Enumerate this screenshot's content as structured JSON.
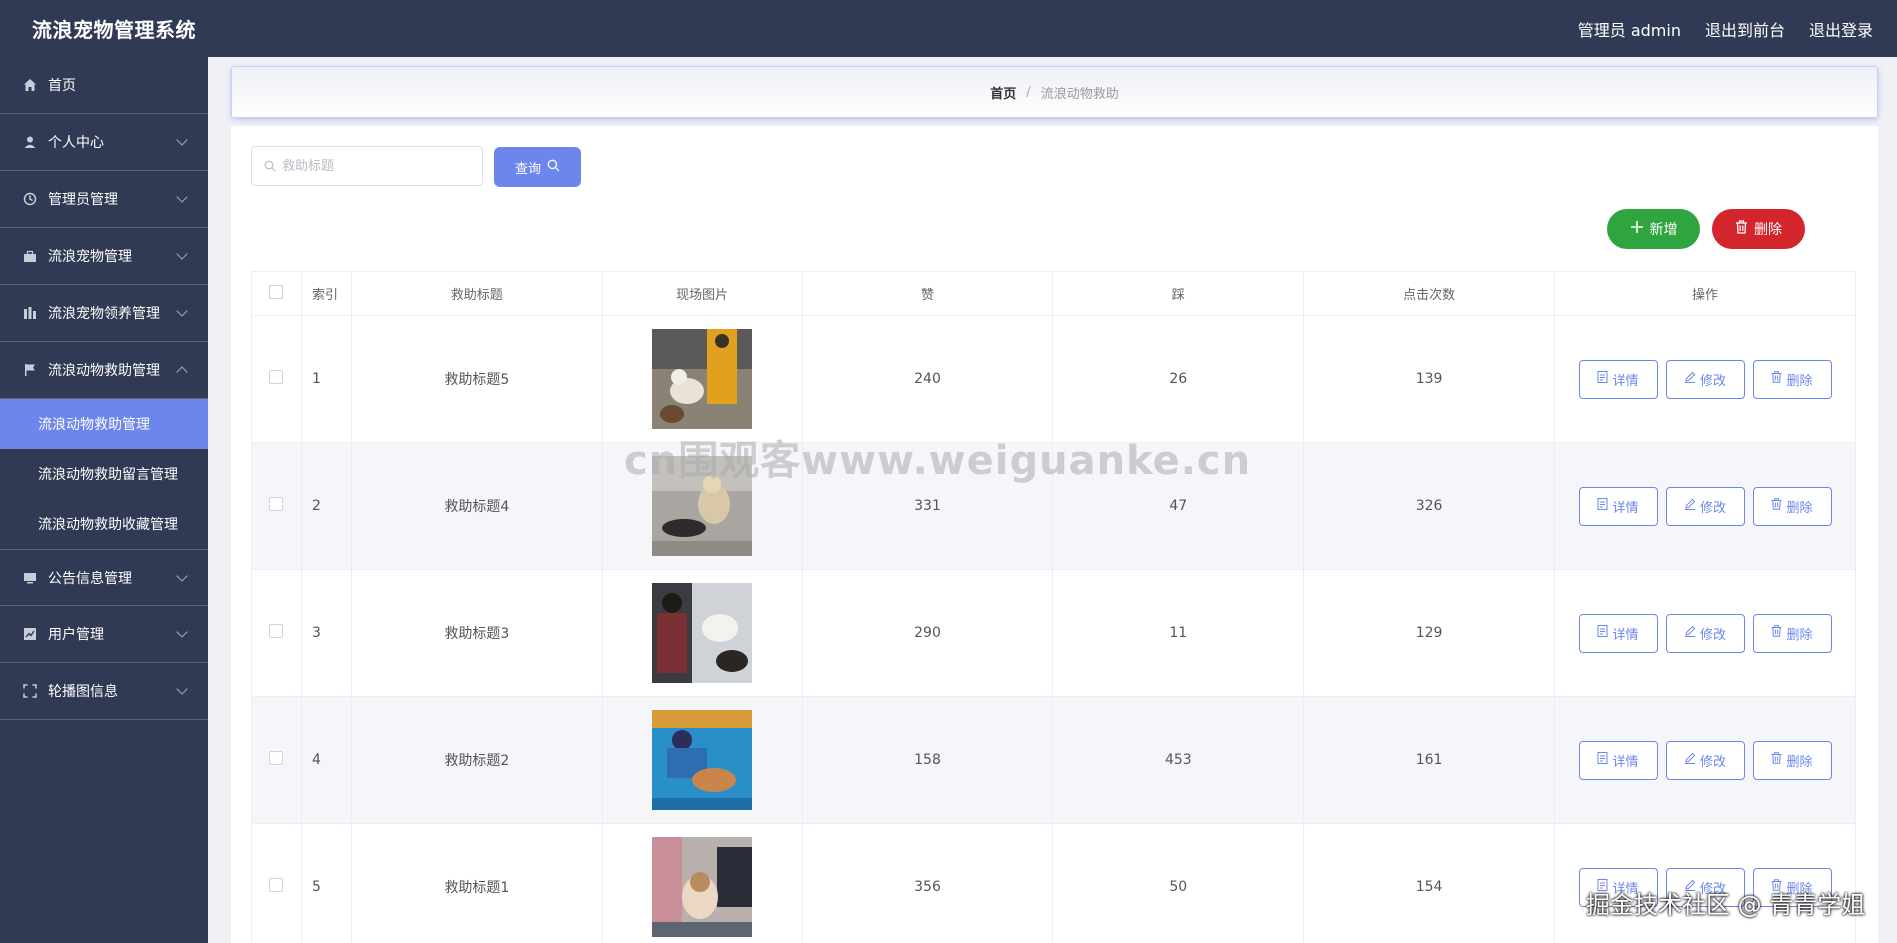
{
  "app": {
    "title": "流浪宠物管理系统"
  },
  "header": {
    "admin_label": "管理员 admin",
    "front_link": "退出到前台",
    "logout_link": "退出登录"
  },
  "sidebar": {
    "items": [
      {
        "label": "首页",
        "icon": "home-icon"
      },
      {
        "label": "个人中心",
        "icon": "user-icon"
      },
      {
        "label": "管理员管理",
        "icon": "clock-icon"
      },
      {
        "label": "流浪宠物管理",
        "icon": "suitcase-icon"
      },
      {
        "label": "流浪宠物领养管理",
        "icon": "bar-chart-icon"
      },
      {
        "label": "流浪动物救助管理",
        "icon": "flag-icon"
      },
      {
        "label": "公告信息管理",
        "icon": "monitor-icon"
      },
      {
        "label": "用户管理",
        "icon": "line-chart-icon"
      },
      {
        "label": "轮播图信息",
        "icon": "fullscreen-icon"
      }
    ],
    "sub_items": [
      "流浪动物救助管理",
      "流浪动物救助留言管理",
      "流浪动物救助收藏管理"
    ]
  },
  "breadcrumb": {
    "home": "首页",
    "separator": "/",
    "current": "流浪动物救助"
  },
  "search": {
    "placeholder": "救助标题",
    "query_label": "查询"
  },
  "actions": {
    "add_label": "新增",
    "delete_label": "删除"
  },
  "table": {
    "headers": [
      "索引",
      "救助标题",
      "现场图片",
      "赞",
      "踩",
      "点击次数",
      "操作"
    ],
    "rows": [
      {
        "index": "1",
        "title": "救助标题5",
        "likes": "240",
        "dislikes": "26",
        "clicks": "139"
      },
      {
        "index": "2",
        "title": "救助标题4",
        "likes": "331",
        "dislikes": "47",
        "clicks": "326"
      },
      {
        "index": "3",
        "title": "救助标题3",
        "likes": "290",
        "dislikes": "11",
        "clicks": "129"
      },
      {
        "index": "4",
        "title": "救助标题2",
        "likes": "158",
        "dislikes": "453",
        "clicks": "161"
      },
      {
        "index": "5",
        "title": "救助标题1",
        "likes": "356",
        "dislikes": "50",
        "clicks": "154"
      }
    ],
    "row_actions": {
      "detail": "详情",
      "edit": "修改",
      "delete": "删除"
    }
  },
  "watermark": "cn围观客www.weiguanke.cn",
  "corner_mark": "掘金技术社区 @ 青青学姐",
  "colors": {
    "sidebar_bg": "#313a54",
    "accent": "#6d86ec",
    "success": "#2fa43f",
    "danger": "#d3252c"
  }
}
